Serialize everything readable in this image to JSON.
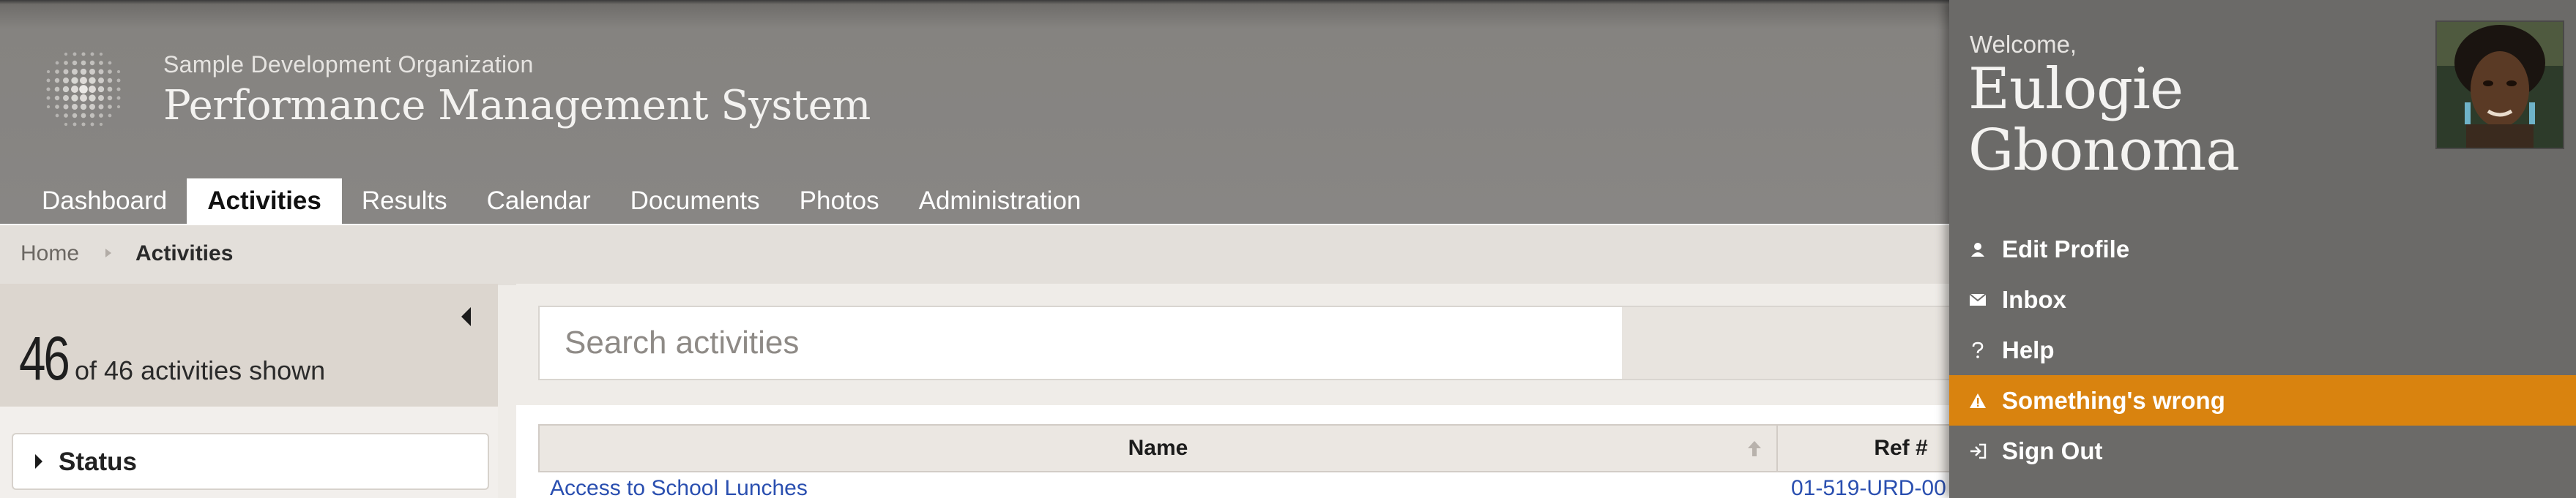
{
  "header": {
    "org_name": "Sample Development Organization",
    "system_name": "Performance Management System",
    "logo_icon": "globe-dots-logo"
  },
  "nav": {
    "items": [
      {
        "label": "Dashboard"
      },
      {
        "label": "Activities",
        "active": true
      },
      {
        "label": "Results"
      },
      {
        "label": "Calendar"
      },
      {
        "label": "Documents"
      },
      {
        "label": "Photos"
      },
      {
        "label": "Administration"
      }
    ]
  },
  "breadcrumb": {
    "home": "Home",
    "current": "Activities"
  },
  "sidebar": {
    "count_shown": "46",
    "count_rest": "of 46 activities shown",
    "status_label": "Status"
  },
  "search": {
    "placeholder": "Search activities"
  },
  "table": {
    "columns": [
      "Name",
      "Ref #"
    ],
    "first_row": {
      "name": "Access to School Lunches",
      "ref": "01-519-URD-00"
    }
  },
  "user_menu": {
    "welcome": "Welcome,",
    "name": "Eulogie Gbonoma",
    "items": [
      {
        "label": "Edit Profile",
        "icon": "person-icon"
      },
      {
        "label": "Inbox",
        "icon": "envelope-icon"
      },
      {
        "label": "Help",
        "icon": "question-icon"
      },
      {
        "label": "Something's wrong",
        "icon": "warning-icon"
      },
      {
        "label": "Sign Out",
        "icon": "sign-out-icon"
      }
    ]
  },
  "colors": {
    "header_bg": "#888684",
    "alert_orange": "#d9830f",
    "panel_bg": "#6b6a68",
    "link_blue": "#2a4fb0"
  }
}
